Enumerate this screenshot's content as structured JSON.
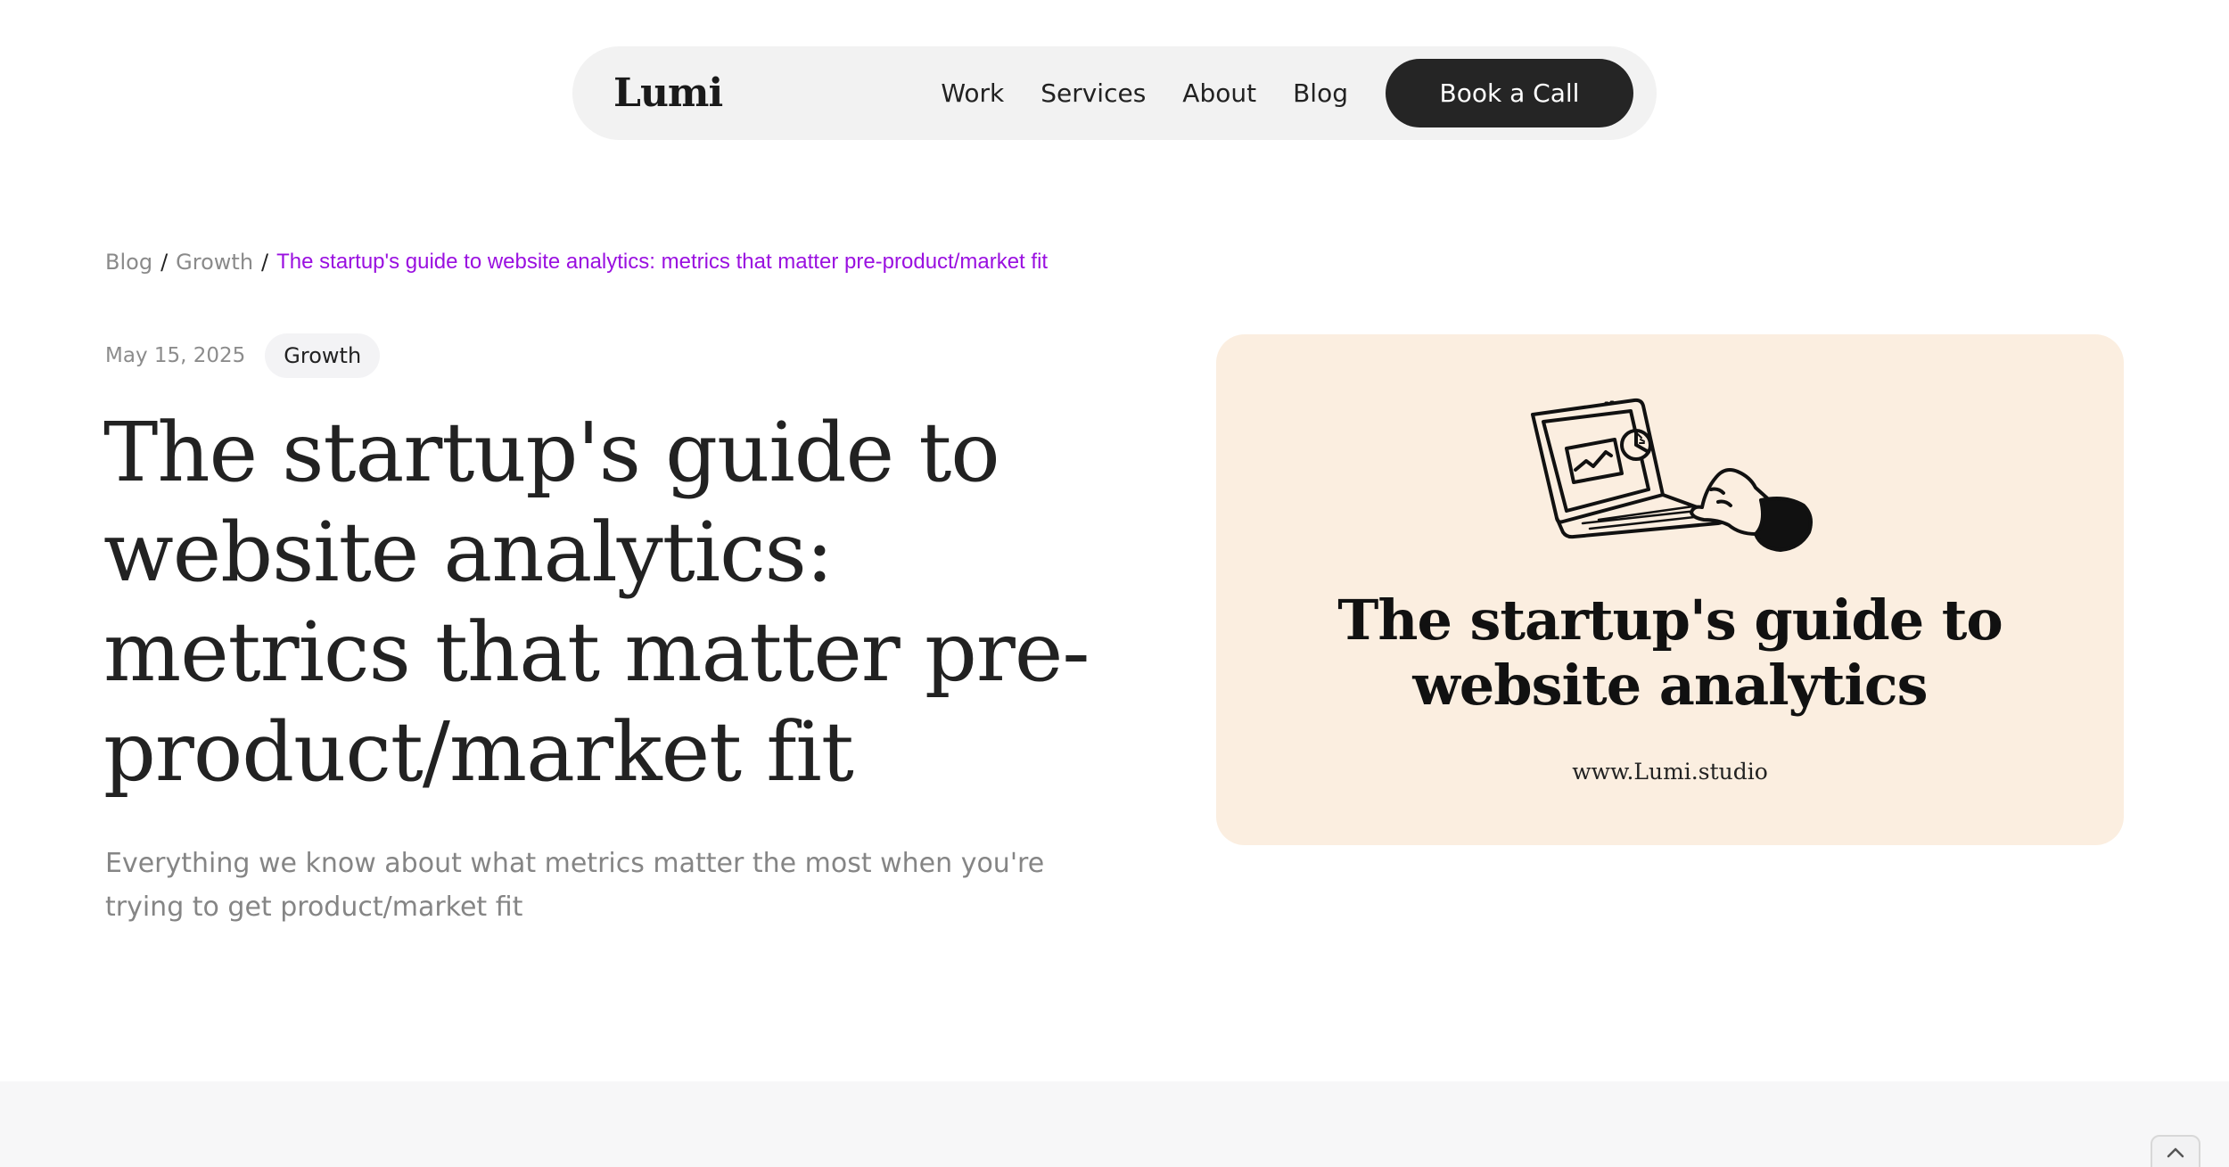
{
  "nav": {
    "logo": "Lumi",
    "links": [
      "Work",
      "Services",
      "About",
      "Blog"
    ],
    "cta": "Book a Call"
  },
  "breadcrumb": {
    "items": [
      "Blog",
      "Growth"
    ],
    "separator": "/",
    "current": "The startup's guide to website analytics: metrics that matter pre-product/market fit"
  },
  "post": {
    "date": "May 15, 2025",
    "tag": "Growth",
    "title": "The startup's guide to website analytics: metrics that matter pre-product/market fit",
    "subtitle": "Everything we know about what metrics matter the most when you're trying to get product/market fit"
  },
  "hero": {
    "title_line1": "The startup's guide to",
    "title_line2": "website analytics",
    "url": "www.Lumi.studio",
    "illustration_icon": "laptop-analytics-icon"
  },
  "colors": {
    "accent": "#9a10e0",
    "cta_bg": "#252525",
    "hero_bg": "#fbeee0",
    "nav_bg": "#f2f2f2"
  }
}
